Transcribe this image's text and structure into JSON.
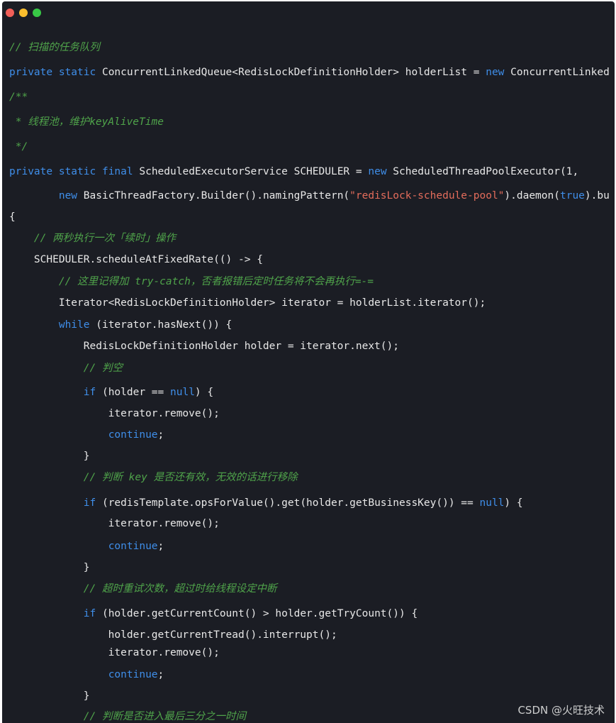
{
  "window": {
    "controls": [
      {
        "name": "close",
        "color": "#f25f58"
      },
      {
        "name": "minimize",
        "color": "#fbbe2e"
      },
      {
        "name": "maximize",
        "color": "#38c846"
      }
    ],
    "background": "#1b1d24"
  },
  "colors": {
    "keyword": "#3f8ee9",
    "comment": "#4fa34a",
    "string": "#e36c5b",
    "text": "#e8e8e8"
  },
  "code": {
    "lines": [
      {
        "tokens": [
          {
            "t": "cm",
            "text": "// 扫描的任务队列"
          }
        ]
      },
      {
        "tokens": [
          {
            "t": "kw",
            "text": "private"
          },
          {
            "t": "pl",
            "text": " "
          },
          {
            "t": "kw",
            "text": "static"
          },
          {
            "t": "pl",
            "text": " ConcurrentLinkedQueue<RedisLockDefinitionHolder> holderList = "
          },
          {
            "t": "kw",
            "text": "new"
          },
          {
            "t": "pl",
            "text": " ConcurrentLinked"
          }
        ]
      },
      {
        "tokens": [
          {
            "t": "cm",
            "text": "/**"
          }
        ]
      },
      {
        "tokens": [
          {
            "t": "cm",
            "text": " * 线程池，维护keyAliveTime"
          }
        ]
      },
      {
        "tokens": [
          {
            "t": "cm",
            "text": " */"
          }
        ]
      },
      {
        "tokens": [
          {
            "t": "kw",
            "text": "private"
          },
          {
            "t": "pl",
            "text": " "
          },
          {
            "t": "kw",
            "text": "static"
          },
          {
            "t": "pl",
            "text": " "
          },
          {
            "t": "kw",
            "text": "final"
          },
          {
            "t": "pl",
            "text": " ScheduledExecutorService SCHEDULER = "
          },
          {
            "t": "kw",
            "text": "new"
          },
          {
            "t": "pl",
            "text": " ScheduledThreadPoolExecutor(1,"
          }
        ]
      },
      {
        "tokens": [
          {
            "t": "pl",
            "text": "        "
          },
          {
            "t": "kw",
            "text": "new"
          },
          {
            "t": "pl",
            "text": " BasicThreadFactory.Builder().namingPattern("
          },
          {
            "t": "st",
            "text": "\"redisLock-schedule-pool\""
          },
          {
            "t": "pl",
            "text": ").daemon("
          },
          {
            "t": "kw",
            "text": "true"
          },
          {
            "t": "pl",
            "text": ").bu"
          }
        ]
      },
      {
        "tokens": [
          {
            "t": "pl",
            "text": "{"
          }
        ]
      },
      {
        "tokens": [
          {
            "t": "pl",
            "text": "    "
          },
          {
            "t": "cm",
            "text": "// 两秒执行一次「续时」操作"
          }
        ]
      },
      {
        "tokens": [
          {
            "t": "pl",
            "text": "    SCHEDULER.scheduleAtFixedRate(() -> {"
          }
        ]
      },
      {
        "tokens": [
          {
            "t": "pl",
            "text": "        "
          },
          {
            "t": "cm",
            "text": "// 这里记得加 try-catch，否者报错后定时任务将不会再执行=-="
          }
        ]
      },
      {
        "tokens": [
          {
            "t": "pl",
            "text": "        Iterator<RedisLockDefinitionHolder> iterator = holderList.iterator();"
          }
        ]
      },
      {
        "tokens": [
          {
            "t": "pl",
            "text": "        "
          },
          {
            "t": "kw",
            "text": "while"
          },
          {
            "t": "pl",
            "text": " (iterator.hasNext()) {"
          }
        ]
      },
      {
        "tokens": [
          {
            "t": "pl",
            "text": "            RedisLockDefinitionHolder holder = iterator.next();"
          }
        ]
      },
      {
        "tokens": [
          {
            "t": "pl",
            "text": "            "
          },
          {
            "t": "cm",
            "text": "// 判空"
          }
        ]
      },
      {
        "tokens": [
          {
            "t": "pl",
            "text": "            "
          },
          {
            "t": "kw",
            "text": "if"
          },
          {
            "t": "pl",
            "text": " (holder == "
          },
          {
            "t": "kw",
            "text": "null"
          },
          {
            "t": "pl",
            "text": ") {"
          }
        ]
      },
      {
        "tokens": [
          {
            "t": "pl",
            "text": "                iterator.remove();"
          }
        ]
      },
      {
        "tokens": [
          {
            "t": "pl",
            "text": "                "
          },
          {
            "t": "kw",
            "text": "continue"
          },
          {
            "t": "pl",
            "text": ";"
          }
        ]
      },
      {
        "tokens": [
          {
            "t": "pl",
            "text": "            }"
          }
        ]
      },
      {
        "tokens": [
          {
            "t": "pl",
            "text": "            "
          },
          {
            "t": "cm",
            "text": "// 判断 key 是否还有效，无效的话进行移除"
          }
        ]
      },
      {
        "tokens": [
          {
            "t": "pl",
            "text": "            "
          },
          {
            "t": "kw",
            "text": "if"
          },
          {
            "t": "pl",
            "text": " (redisTemplate.opsForValue().get(holder.getBusinessKey()) == "
          },
          {
            "t": "kw",
            "text": "null"
          },
          {
            "t": "pl",
            "text": ") {"
          }
        ]
      },
      {
        "tokens": [
          {
            "t": "pl",
            "text": "                iterator.remove();"
          }
        ]
      },
      {
        "tokens": [
          {
            "t": "pl",
            "text": "                "
          },
          {
            "t": "kw",
            "text": "continue"
          },
          {
            "t": "pl",
            "text": ";"
          }
        ]
      },
      {
        "tokens": [
          {
            "t": "pl",
            "text": "            }"
          }
        ]
      },
      {
        "tokens": [
          {
            "t": "pl",
            "text": "            "
          },
          {
            "t": "cm",
            "text": "// 超时重试次数，超过时给线程设定中断"
          }
        ]
      },
      {
        "tokens": [
          {
            "t": "pl",
            "text": "            "
          },
          {
            "t": "kw",
            "text": "if"
          },
          {
            "t": "pl",
            "text": " (holder.getCurrentCount() > holder.getTryCount()) {"
          }
        ]
      },
      {
        "tokens": [
          {
            "t": "pl",
            "text": "                holder.getCurrentTread().interrupt();"
          }
        ]
      },
      {
        "tokens": [
          {
            "t": "pl",
            "text": "                iterator.remove();"
          }
        ]
      },
      {
        "tokens": [
          {
            "t": "pl",
            "text": "                "
          },
          {
            "t": "kw",
            "text": "continue"
          },
          {
            "t": "pl",
            "text": ";"
          }
        ]
      },
      {
        "tokens": [
          {
            "t": "pl",
            "text": "            }"
          }
        ]
      },
      {
        "tokens": [
          {
            "t": "pl",
            "text": "            "
          },
          {
            "t": "cm",
            "text": "// 判断是否进入最后三分之一时间"
          }
        ]
      }
    ]
  },
  "watermark": "CSDN @火旺技术"
}
